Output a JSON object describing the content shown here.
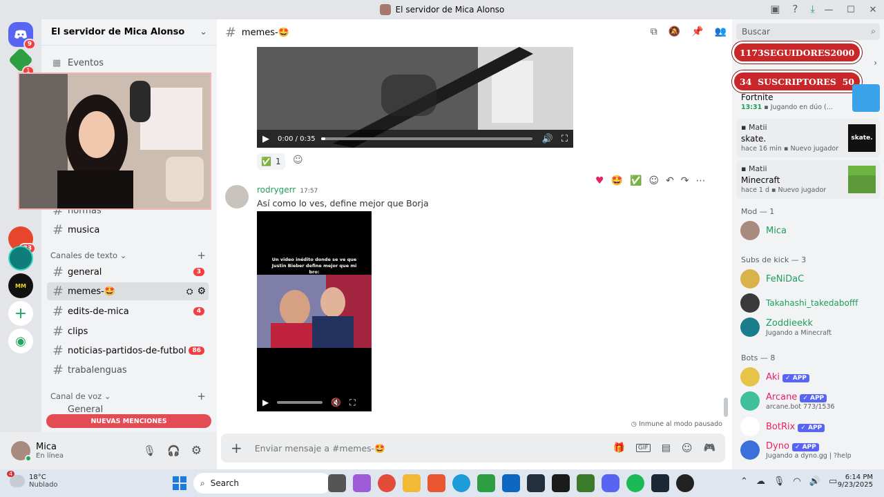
{
  "window": {
    "title": "El servidor de Mica Alonso",
    "controls": [
      "—",
      "☐",
      "✕"
    ]
  },
  "guilds": {
    "badges": [
      "9",
      "1",
      "33"
    ]
  },
  "sidebar": {
    "server_name": "El servidor de Mica Alonso",
    "events_label": "Eventos",
    "top_channels": [
      {
        "name": "normas"
      },
      {
        "name": "musica"
      }
    ],
    "text_category": "Canales de texto",
    "text_channels": [
      {
        "name": "general",
        "badge": "3"
      },
      {
        "name": "memes-🤩",
        "badge": ""
      },
      {
        "name": "edits-de-mica",
        "badge": "4"
      },
      {
        "name": "clips",
        "badge": ""
      },
      {
        "name": "noticias-partidos-de-futbol",
        "badge": "86"
      },
      {
        "name": "trabalenguas",
        "badge": ""
      }
    ],
    "voice_category": "Canal de voz",
    "voice_first": "General",
    "mentions_label": "NUEVAS MENCIONES"
  },
  "user": {
    "name": "Mica",
    "status": "En línea"
  },
  "channel": {
    "name": "memes-🤩"
  },
  "messages": {
    "video1_time": "0:00 / 0:35",
    "reaction_emoji": "✅",
    "reaction_count": "1",
    "author": "rodrygerr",
    "time": "17:57",
    "text": "Así como lo ves, define mejor que Borja",
    "video2_caption": "Un video inédito donde se ve que Justin Bieber define mejor que mi bro:",
    "slowmode_notice": "Inmune al modo pausado"
  },
  "composer": {
    "placeholder": "Enviar mensaje a #memes-🤩"
  },
  "members": {
    "search_placeholder": "Buscar",
    "overlay": [
      {
        "left": "1173",
        "label": "SEGUIDORES",
        "right": "2000"
      },
      {
        "left": "34",
        "label": "SUSCRIPTORES",
        "right": "50"
      }
    ],
    "activities": [
      {
        "user": "",
        "game": "Fortnite",
        "time": "13:31",
        "detail": "Jugando en dúo (..."
      },
      {
        "user": "Matii",
        "game": "skate.",
        "time": "hace 16 min",
        "detail": "Nuevo jugador",
        "thumb_text": "skate."
      },
      {
        "user": "Matii",
        "game": "Minecraft",
        "time": "hace 1 d",
        "detail": "Nuevo jugador"
      }
    ],
    "groups": [
      {
        "title": "Mod — 1",
        "members": [
          {
            "name": "Mica",
            "color": "#1f9e5c",
            "sub": ""
          }
        ]
      },
      {
        "title": "Subs de kick — 3",
        "members": [
          {
            "name": "FeNiDaC",
            "color": "#1f9e5c",
            "sub": ""
          },
          {
            "name": "Takahashi_takedabofff",
            "color": "#1f9e5c",
            "sub": ""
          },
          {
            "name": "Zoddieekk",
            "color": "#1f9e5c",
            "sub": "Jugando a Minecraft"
          }
        ]
      },
      {
        "title": "Bots — 8",
        "members": [
          {
            "name": "Aki",
            "color": "#e91e63",
            "sub": "",
            "app": "APP"
          },
          {
            "name": "Arcane",
            "color": "#e91e63",
            "sub": "arcane.bot 773/1536",
            "app": "APP"
          },
          {
            "name": "BotRix",
            "color": "#e91e63",
            "sub": "",
            "app": "APP"
          },
          {
            "name": "Dyno",
            "color": "#e91e63",
            "sub": "Jugando a dyno.gg | ?help",
            "app": "APP"
          }
        ]
      }
    ]
  },
  "taskbar": {
    "weather_temp": "18°C",
    "weather_desc": "Nublado",
    "weather_badge": "4",
    "search_label": "Search",
    "time": "6:14 PM",
    "date": "9/23/2025"
  }
}
